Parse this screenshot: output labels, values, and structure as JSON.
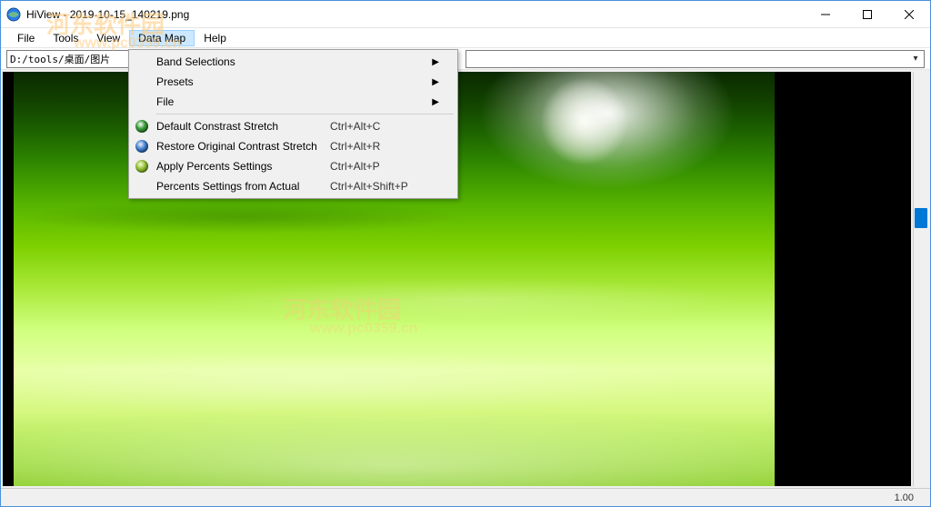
{
  "window": {
    "title": "HiView - 2019-10-15_140219.png"
  },
  "menubar": {
    "items": [
      {
        "label": "File"
      },
      {
        "label": "Tools"
      },
      {
        "label": "View"
      },
      {
        "label": "Data Map"
      },
      {
        "label": "Help"
      }
    ]
  },
  "toolbar": {
    "path": "D:/tools/桌面/图片"
  },
  "dropdown": {
    "items": [
      {
        "label": "Band Selections",
        "submenu": true
      },
      {
        "label": "Presets",
        "submenu": true
      },
      {
        "label": "File",
        "submenu": true
      },
      {
        "sep": true
      },
      {
        "label": "Default Constrast Stretch",
        "shortcut": "Ctrl+Alt+C",
        "icon": "globe"
      },
      {
        "label": "Restore Original Contrast Stretch",
        "shortcut": "Ctrl+Alt+R",
        "icon": "swirl"
      },
      {
        "label": "Apply Percents Settings",
        "shortcut": "Ctrl+Alt+P",
        "icon": "refresh"
      },
      {
        "label": "Percents Settings from Actual",
        "shortcut": "Ctrl+Alt+Shift+P"
      }
    ]
  },
  "status": {
    "zoom": "1.00"
  },
  "watermark": {
    "main": "河东软件园",
    "sub": "www.pc0359.cn"
  }
}
